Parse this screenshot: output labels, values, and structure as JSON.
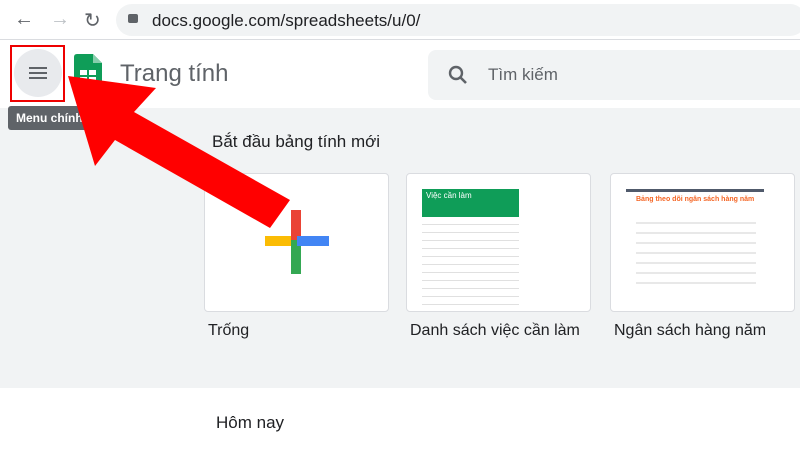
{
  "browser": {
    "url": "docs.google.com/spreadsheets/u/0/"
  },
  "app": {
    "title": "Trang tính",
    "tooltip": "Menu chính"
  },
  "search": {
    "placeholder": "Tìm kiếm"
  },
  "templates": {
    "heading": "Bắt đầu bảng tính mới",
    "items": [
      {
        "label": "Trống"
      },
      {
        "label": "Danh sách việc cần làm",
        "preview_title": "Việc cần làm"
      },
      {
        "label": "Ngân sách hàng năm",
        "preview_title": "Bảng theo dõi ngân sách hàng năm"
      }
    ]
  },
  "recent": {
    "heading": "Hôm nay"
  }
}
